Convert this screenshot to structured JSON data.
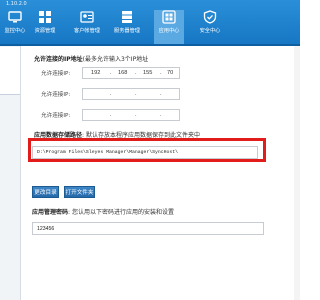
{
  "app": {
    "version": "1.10.2.0"
  },
  "toolbar": {
    "items": [
      {
        "label": "监控中心",
        "icon": "monitor-icon"
      },
      {
        "label": "资源管理",
        "icon": "resource-grid-icon"
      },
      {
        "label": "客户帐管理",
        "icon": "user-card-icon"
      },
      {
        "label": "服务器管理",
        "icon": "server-icon"
      },
      {
        "label": "应用中心",
        "icon": "app-center-icon",
        "active": true
      },
      {
        "label": "安全中心",
        "icon": "shield-icon"
      }
    ]
  },
  "allowed_ips": {
    "title": "允许连接的IP地址",
    "hint": "(最多允许输入3个IP地址",
    "fields": [
      {
        "label": "允许连接IP:",
        "octets": [
          "192",
          "168",
          "155",
          "70"
        ]
      },
      {
        "label": "允许连接IP:",
        "octets": [
          "",
          "",
          "",
          ""
        ]
      },
      {
        "label": "允许连接IP:",
        "octets": [
          "",
          "",
          "",
          ""
        ]
      }
    ]
  },
  "storage": {
    "title": "应用数据存储路径",
    "hint": ": 默认存放本程序应用数据保存到此文件夹中",
    "path": "D:\\Program Files\\Sleyes Manager\\Manager\\SyncHost\\",
    "change_label": "更改目录",
    "open_label": "打开文件夹"
  },
  "password": {
    "title": "应用管理密码",
    "hint": ": 您认用以下密码进行应用的安装和设置",
    "value": "123456"
  },
  "colors": {
    "toolbar": "#1f82ce",
    "highlight": "#e21b1b",
    "button": "#2a6fb0"
  }
}
